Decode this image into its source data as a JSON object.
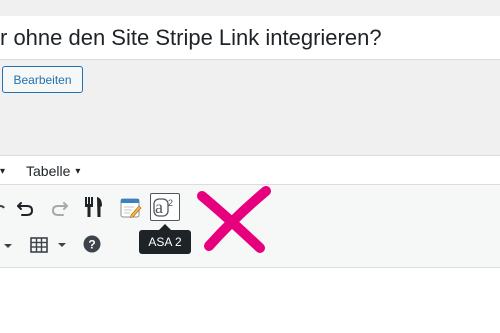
{
  "post": {
    "title_visible": "r ohne den Site Stripe Link integrieren?"
  },
  "buttons": {
    "edit_label": "Bearbeiten"
  },
  "editor": {
    "menubar": {
      "partial_caret": "▾",
      "table_label": "Tabelle",
      "table_caret": "▾"
    },
    "toolbar_row1": [
      "partial-tool-icon",
      "undo-icon",
      "redo-icon",
      "fork-knife-icon",
      "edit-note-icon",
      "asa2-icon"
    ],
    "toolbar_row2": [
      "partial-caret-icon",
      "table-icon",
      "table-dropdown-icon",
      "help-icon"
    ],
    "tooltip": "ASA 2"
  },
  "colors": {
    "accent_blue": "#2271b1",
    "annotation_pink": "#e6007e",
    "tooltip_bg": "#1d2327",
    "panel_gray": "#f0f0f1"
  }
}
